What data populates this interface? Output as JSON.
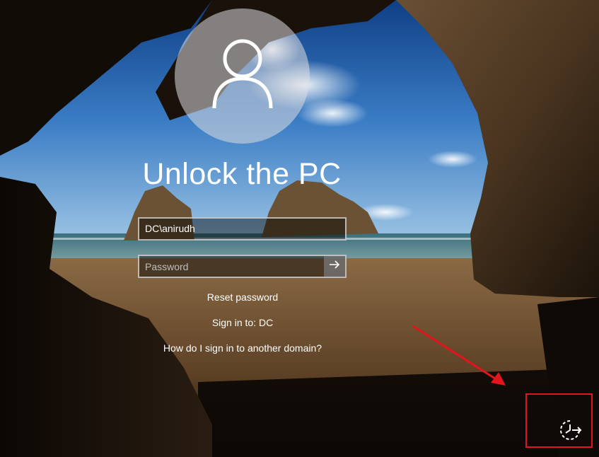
{
  "lockscreen": {
    "title": "Unlock the PC",
    "username_value": "DC\\anirudh",
    "password_placeholder": "Password",
    "submit_icon": "arrow-right-icon",
    "avatar_icon": "user-icon"
  },
  "links": {
    "reset_password": "Reset password",
    "sign_in_to": "Sign in to: DC",
    "other_domain": "How do I sign in to another domain?"
  },
  "corner": {
    "ease_of_access_icon": "ease-of-access-icon"
  },
  "annotation": {
    "color": "#e3141b"
  }
}
